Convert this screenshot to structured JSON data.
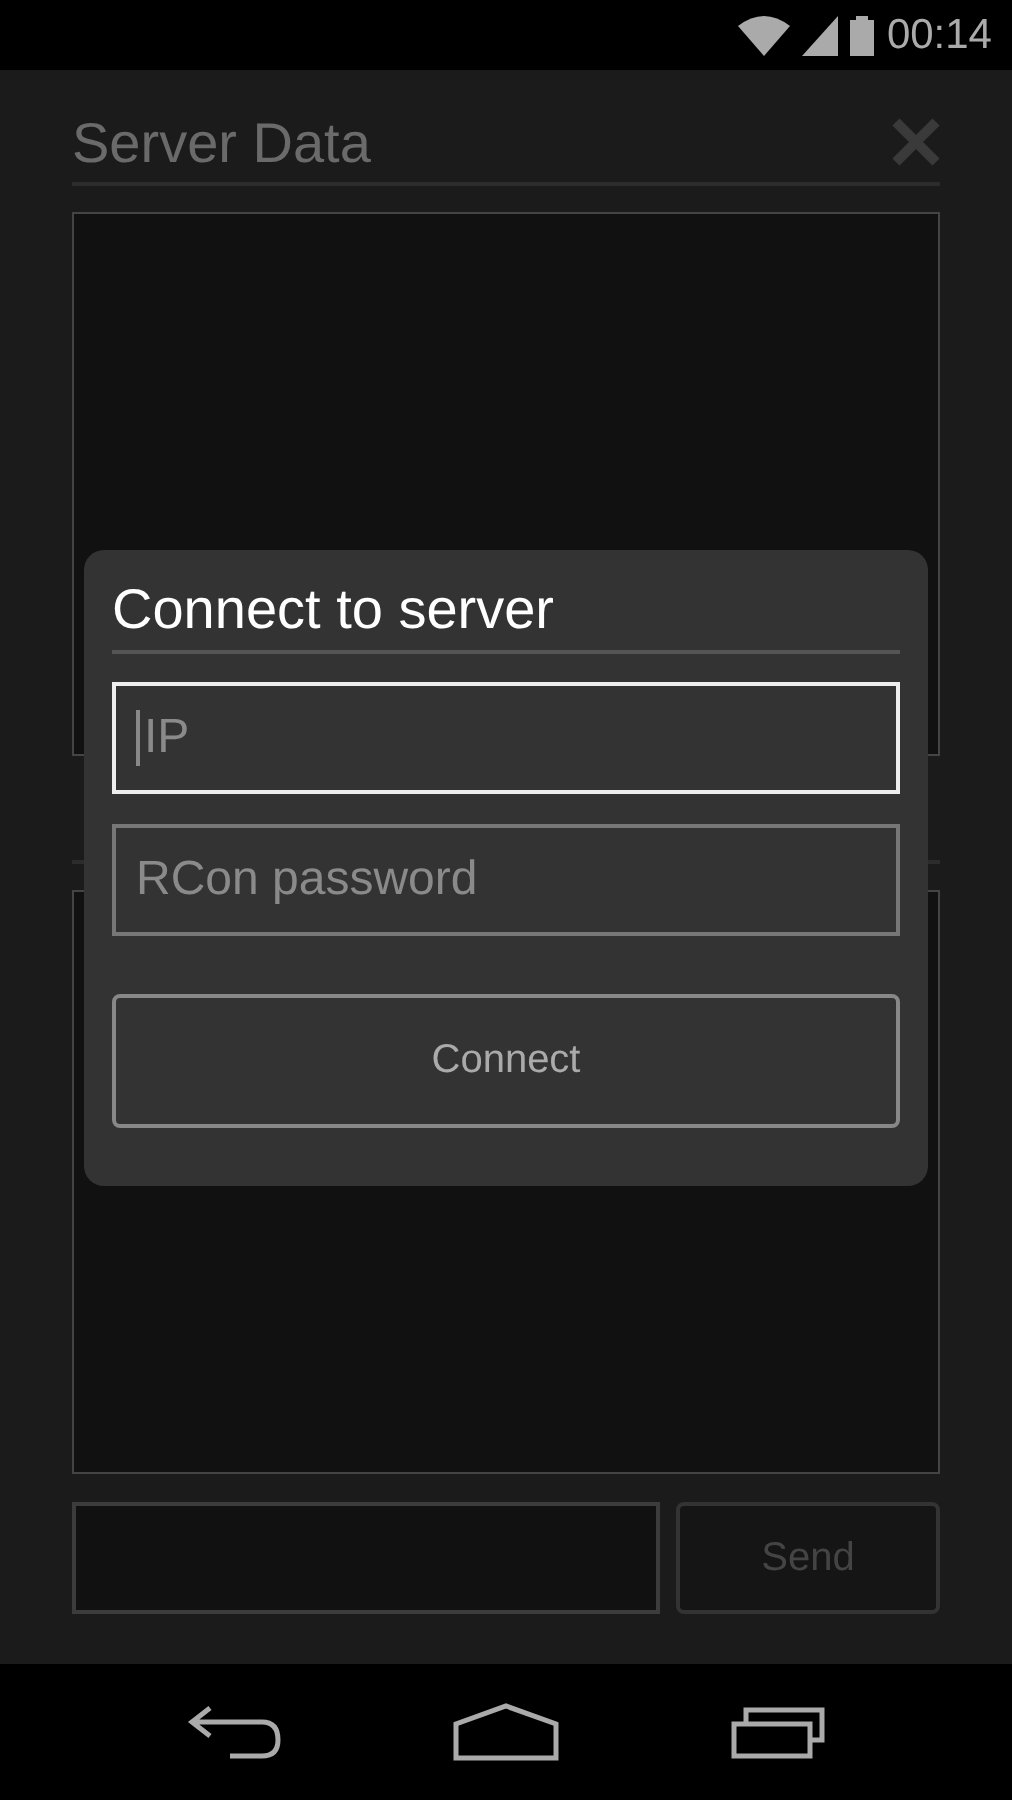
{
  "status_bar": {
    "time": "00:14"
  },
  "screen": {
    "title": "Server Data",
    "send_button": {
      "label": "Send",
      "disabled": true
    }
  },
  "dialog": {
    "title": "Connect to server",
    "fields": [
      {
        "placeholder": "IP",
        "focused": true
      },
      {
        "placeholder": "RCon password",
        "focused": false
      }
    ],
    "button": "Connect"
  }
}
